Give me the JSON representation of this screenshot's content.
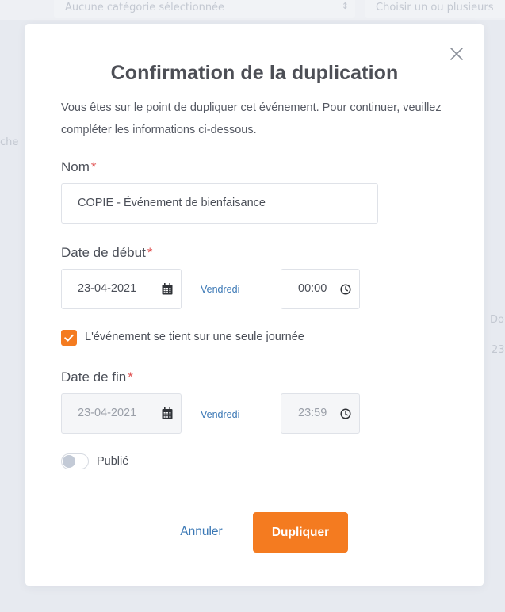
{
  "background": {
    "category_select": "Aucune catégorie sélectionnée",
    "multiselect_placeholder": "Choisir un ou plusieurs",
    "left_fragment": "che",
    "right_fragment_1": "Do",
    "right_fragment_2": "23"
  },
  "modal": {
    "title": "Confirmation de la duplication",
    "description": "Vous êtes sur le point de dupliquer cet événement. Pour continuer, veuillez compléter les informations ci-dessous.",
    "required_mark": "*",
    "name": {
      "label": "Nom",
      "value": "COPIE - Événement de bienfaisance"
    },
    "start": {
      "label": "Date de début",
      "date": "23-04-2021",
      "day": "Vendredi",
      "time": "00:00"
    },
    "single_day": {
      "checked": true,
      "label": "L'événement se tient sur une seule journée"
    },
    "end": {
      "label": "Date de fin",
      "date": "23-04-2021",
      "day": "Vendredi",
      "time": "23:59"
    },
    "published": {
      "on": false,
      "label": "Publié"
    },
    "cancel_label": "Annuler",
    "duplicate_label": "Dupliquer"
  },
  "colors": {
    "accent": "#f47b20",
    "link": "#3b78b5",
    "required": "#e05252"
  }
}
